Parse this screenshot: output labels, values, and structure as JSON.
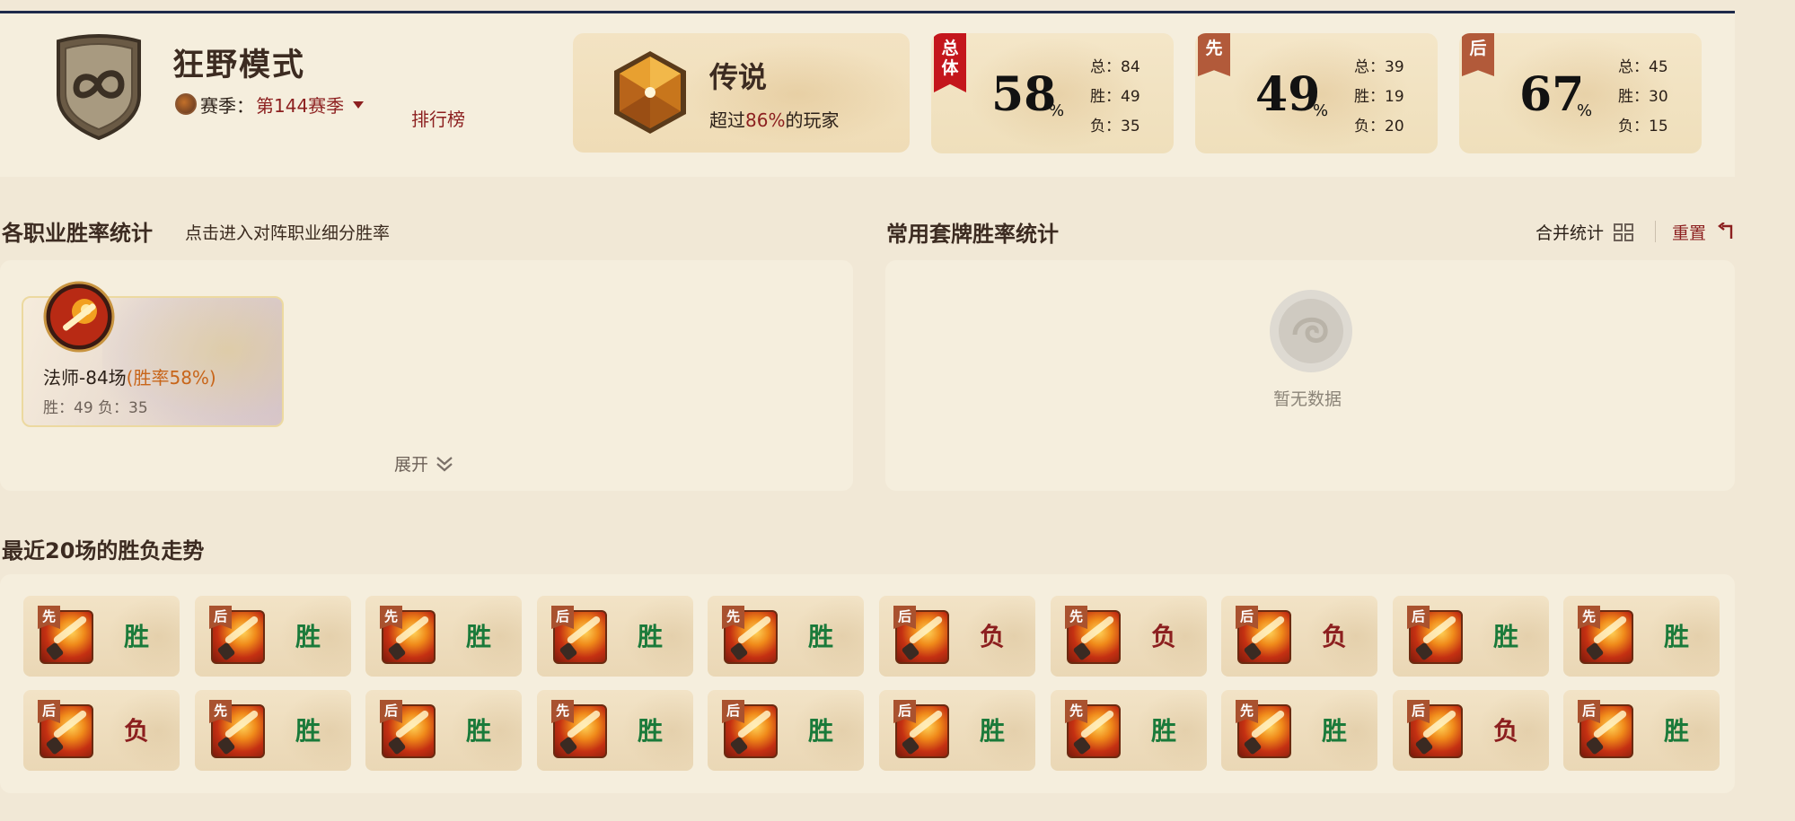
{
  "header": {
    "mode_title": "狂野模式",
    "season_label": "赛季：",
    "season_value": "第144赛季",
    "ranking_link": "排行榜"
  },
  "legend": {
    "title": "传说",
    "sub_prefix": "超过",
    "sub_value": "86%",
    "sub_suffix": "的玩家"
  },
  "stats": [
    {
      "ribbon": "总体",
      "pct": "58",
      "pct_sign": "%",
      "total": "总：84",
      "wins": "胜：49",
      "losses": "负：35"
    },
    {
      "ribbon": "先",
      "pct": "49",
      "pct_sign": "%",
      "total": "总：39",
      "wins": "胜：19",
      "losses": "负：20"
    },
    {
      "ribbon": "后",
      "pct": "67",
      "pct_sign": "%",
      "total": "总：45",
      "wins": "胜：30",
      "losses": "负：15"
    }
  ],
  "class_section": {
    "title": "各职业胜率统计",
    "hint": "点击进入对阵职业细分胜率",
    "cards": [
      {
        "name": "法师-84场",
        "winrate": "(胜率58%)",
        "record": "胜：49 负：35"
      }
    ],
    "expand_label": "展开"
  },
  "deck_section": {
    "title": "常用套牌胜率统计",
    "merge_label": "合并统计",
    "reset_label": "重置",
    "empty_text": "暂无数据"
  },
  "recent_section": {
    "title": "最近20场的胜负走势",
    "games": [
      {
        "order": "先",
        "result": "胜"
      },
      {
        "order": "后",
        "result": "胜"
      },
      {
        "order": "先",
        "result": "胜"
      },
      {
        "order": "后",
        "result": "胜"
      },
      {
        "order": "先",
        "result": "胜"
      },
      {
        "order": "后",
        "result": "负"
      },
      {
        "order": "先",
        "result": "负"
      },
      {
        "order": "后",
        "result": "负"
      },
      {
        "order": "后",
        "result": "胜"
      },
      {
        "order": "先",
        "result": "胜"
      },
      {
        "order": "后",
        "result": "负"
      },
      {
        "order": "先",
        "result": "胜"
      },
      {
        "order": "后",
        "result": "胜"
      },
      {
        "order": "先",
        "result": "胜"
      },
      {
        "order": "后",
        "result": "胜"
      },
      {
        "order": "后",
        "result": "胜"
      },
      {
        "order": "先",
        "result": "胜"
      },
      {
        "order": "先",
        "result": "胜"
      },
      {
        "order": "后",
        "result": "负"
      },
      {
        "order": "后",
        "result": "胜"
      }
    ]
  },
  "colors": {
    "win": "#1a7a3a",
    "loss": "#8c1f1f",
    "accent_red": "#c4161c",
    "ribbon_brown": "#b25a3a"
  }
}
